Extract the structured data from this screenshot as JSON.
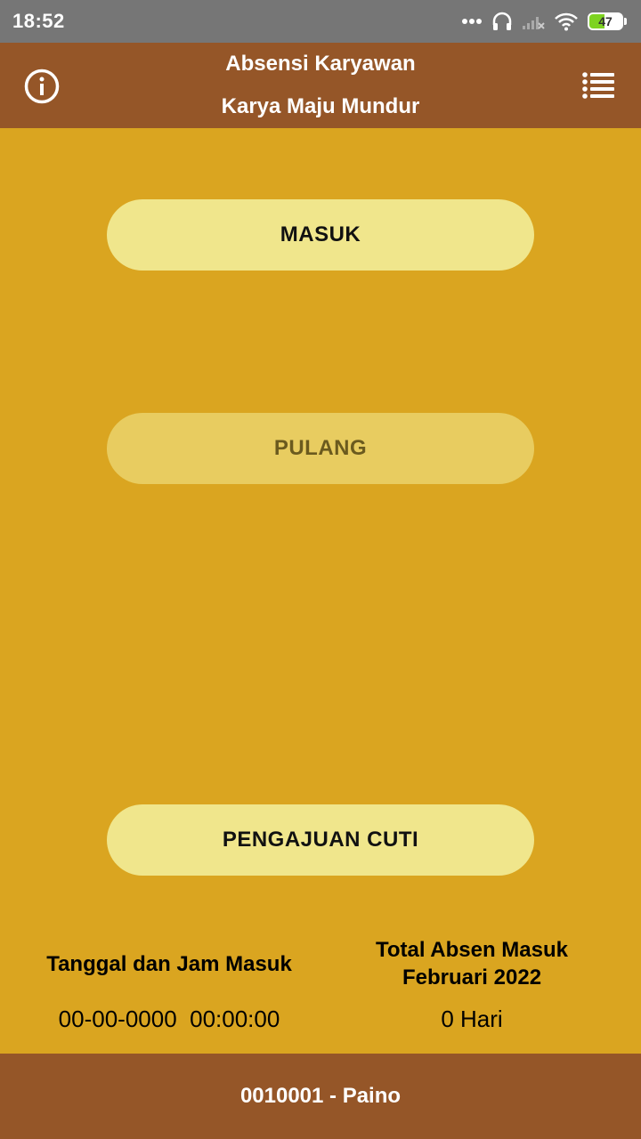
{
  "status_bar": {
    "time": "18:52",
    "battery": "47",
    "icons": [
      "more-dots-icon",
      "headset-icon",
      "signal-no-service-icon",
      "wifi-icon",
      "battery-icon"
    ]
  },
  "header": {
    "title_line1": "Absensi Karyawan",
    "title_line2": "Karya Maju Mundur",
    "left_icon": "info-icon",
    "right_icon": "list-menu-icon"
  },
  "buttons": {
    "masuk": "MASUK",
    "pulang": "PULANG",
    "cuti": "PENGAJUAN CUTI"
  },
  "info": {
    "left_label": "Tanggal dan Jam Masuk",
    "left_value": "00-00-0000  00:00:00",
    "right_label_line1": "Total Absen Masuk",
    "right_label_line2": "Februari 2022",
    "right_value": "0 Hari"
  },
  "footer": {
    "user": "0010001 - Paino"
  },
  "colors": {
    "background": "#DAA520",
    "header": "#955628",
    "button": "#F0E68C",
    "button_disabled": "#E8CC60"
  }
}
